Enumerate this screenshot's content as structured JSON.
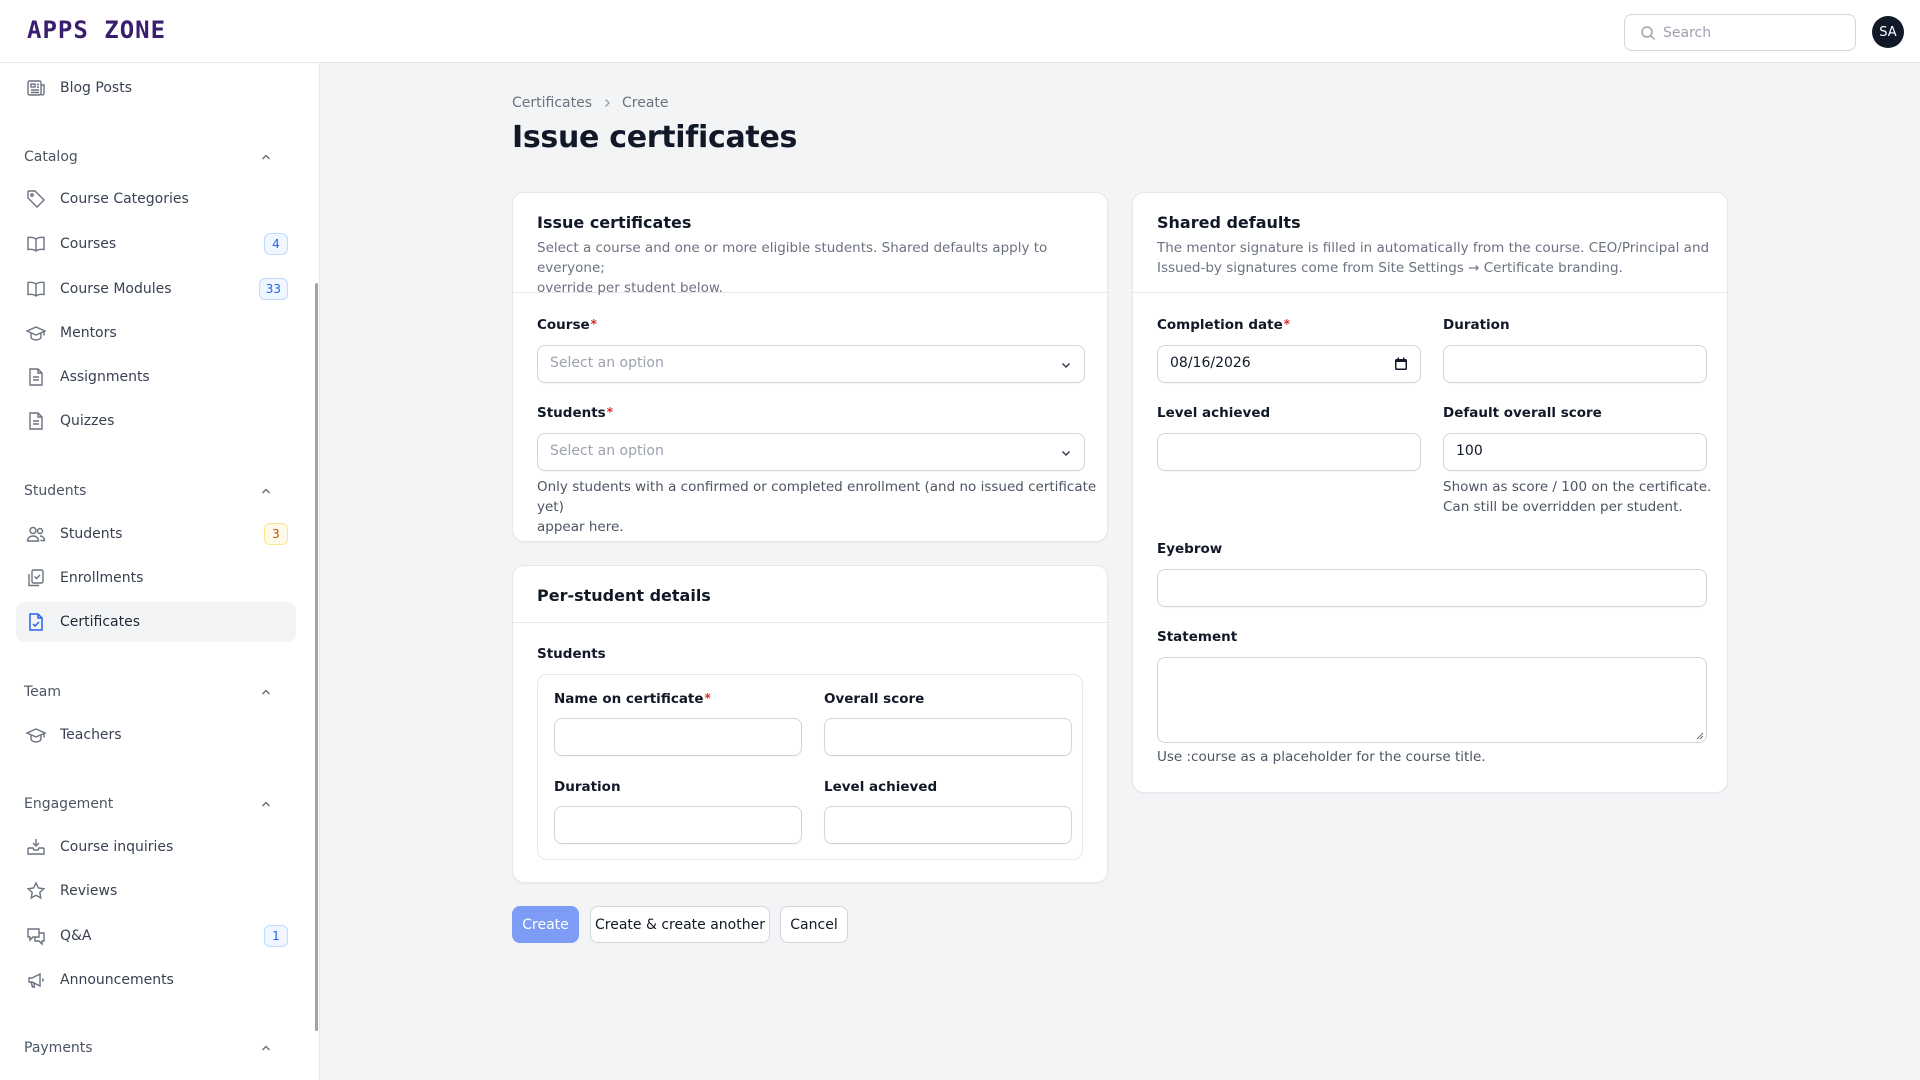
{
  "app": {
    "logo_text": "APPS ZONE"
  },
  "header": {
    "search_placeholder": "Search",
    "avatar_initials": "SA"
  },
  "sidebar": {
    "top_item": {
      "label": "Blog Posts"
    },
    "groups": [
      {
        "label": "Catalog",
        "items": [
          {
            "label": "Course Categories",
            "icon": "tag-icon"
          },
          {
            "label": "Courses",
            "icon": "book-icon",
            "badge": "4"
          },
          {
            "label": "Course Modules",
            "icon": "book-icon",
            "badge": "33"
          },
          {
            "label": "Mentors",
            "icon": "academic-cap-icon"
          },
          {
            "label": "Assignments",
            "icon": "document-icon"
          },
          {
            "label": "Quizzes",
            "icon": "document-icon"
          }
        ]
      },
      {
        "label": "Students",
        "items": [
          {
            "label": "Students",
            "icon": "users-icon",
            "badge": "3"
          },
          {
            "label": "Enrollments",
            "icon": "clipboard-check-icon"
          },
          {
            "label": "Certificates",
            "icon": "document-check-icon",
            "active": true
          }
        ]
      },
      {
        "label": "Team",
        "items": [
          {
            "label": "Teachers",
            "icon": "academic-cap-icon"
          }
        ]
      },
      {
        "label": "Engagement",
        "items": [
          {
            "label": "Course inquiries",
            "icon": "inbox-icon"
          },
          {
            "label": "Reviews",
            "icon": "star-icon"
          },
          {
            "label": "Q&A",
            "icon": "chat-bubbles-icon",
            "badge": "1"
          },
          {
            "label": "Announcements",
            "icon": "megaphone-icon"
          }
        ]
      },
      {
        "label": "Payments",
        "items": []
      }
    ]
  },
  "breadcrumb": {
    "parent": "Certificates",
    "current": "Create"
  },
  "page": {
    "title": "Issue certificates"
  },
  "issue_card": {
    "title": "Issue certificates",
    "description_line1": "Select a course and one or more eligible students. Shared defaults apply to everyone;",
    "description_line2": "override per student below.",
    "course_label": "Course",
    "course_placeholder": "Select an option",
    "students_label": "Students",
    "students_placeholder": "Select an option",
    "students_help_line1": "Only students with a confirmed or completed enrollment (and no issued certificate yet)",
    "students_help_line2": "appear here.",
    "required_mark": "*"
  },
  "per_student_card": {
    "title": "Per-student details",
    "students_label": "Students",
    "name_label": "Name on certificate",
    "overall_score_label": "Overall score",
    "duration_label": "Duration",
    "level_label": "Level achieved"
  },
  "defaults_card": {
    "title": "Shared defaults",
    "description_line1": "The mentor signature is filled in automatically from the course. CEO/Principal and",
    "description_line2": "Issued-by signatures come from Site Settings → Certificate branding.",
    "completion_date_label": "Completion date",
    "completion_date_value": "08/16/2026",
    "duration_label": "Duration",
    "level_label": "Level achieved",
    "default_score_label": "Default overall score",
    "default_score_value": "100",
    "score_help_line1": "Shown as score / 100 on the certificate.",
    "score_help_line2": "Can still be overridden per student.",
    "eyebrow_label": "Eyebrow",
    "statement_label": "Statement",
    "statement_help": "Use :course as a placeholder for the course title."
  },
  "actions": {
    "create": "Create",
    "create_another": "Create & create another",
    "cancel": "Cancel"
  },
  "colors": {
    "primary_button": "#7c9cf5",
    "logo": "#3b1d6e",
    "required": "#dc2626"
  }
}
